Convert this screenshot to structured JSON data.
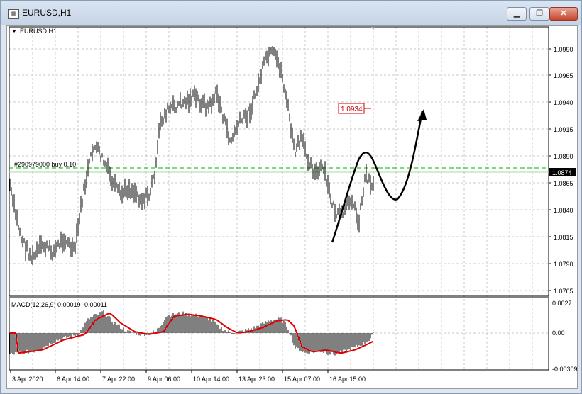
{
  "window": {
    "title": "EURUSD,H1",
    "minimize_label": "▁",
    "restore_label": "❐",
    "close_label": "✕"
  },
  "chart": {
    "symbol_label": "EURUSD,H1",
    "order_label": "#290979000 buy 0.10",
    "current_price_label": "1.0874",
    "annotation_price_label": "1.0934",
    "macd_label": "MACD(12,26,9) 0.00019 -0.00011",
    "price_ticks": [
      "1.0990",
      "1.0965",
      "1.0940",
      "1.0915",
      "1.0890",
      "1.0865",
      "1.0840",
      "1.0815",
      "1.0790",
      "1.0765"
    ],
    "macd_ticks": [
      "0.0027",
      "0.00",
      "-0.00309"
    ],
    "time_ticks": [
      "3 Apr 2020",
      "6 Apr 14:00",
      "7 Apr 22:00",
      "9 Apr 06:00",
      "10 Apr 14:00",
      "13 Apr 23:00",
      "15 Apr 07:00",
      "16 Apr 15:00"
    ]
  },
  "colors": {
    "bars": "#000000",
    "grid": "#c0c0c0",
    "order_line": "#00b000",
    "signal_line": "#e00000",
    "annotation": "#cc0000"
  }
}
